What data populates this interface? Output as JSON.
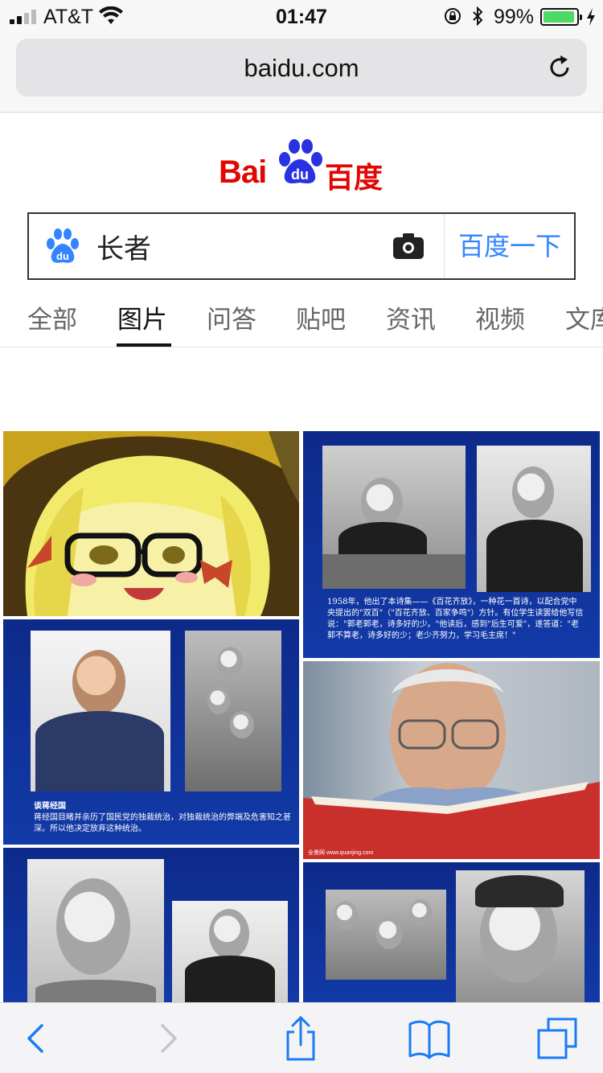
{
  "status_bar": {
    "carrier": "AT&T",
    "time": "01:47",
    "battery_percent": "99%",
    "battery_level": 0.99
  },
  "address_bar": {
    "url": "baidu.com"
  },
  "baidu": {
    "logo_text": "Bai",
    "logo_du": "du",
    "logo_cn": "百度",
    "search_value": "长者",
    "search_button": "百度一下"
  },
  "tabs": [
    {
      "label": "全部"
    },
    {
      "label": "图片",
      "active": true
    },
    {
      "label": "问答"
    },
    {
      "label": "贴吧"
    },
    {
      "label": "资讯"
    },
    {
      "label": "视频"
    },
    {
      "label": "文库"
    }
  ],
  "images": {
    "caption_1": "1958年，他出了本诗集——《百花齐放》，一种花一首诗，以配合党中央提出的\"双百\"（\"百花齐放、百家争鸣\"）方针。有位学生读罢给他写信说：\"郭老郭老，诗多好的少。\"他读后，感到\"后生可爱\"，遂答道：\"老郭不算老，诗多好的少；老少齐努力，学习毛主席！\"",
    "caption_2_title": "谈蒋经国",
    "caption_2": "蒋经国目睹并亲历了国民党的独裁统治，对独裁统治的弊端及危害知之甚深。所以他决定放弃这种统治。",
    "watermark": "全景网 www.quanjing.com"
  },
  "colors": {
    "baidu_red": "#e10601",
    "baidu_blue": "#2932e1",
    "link_blue": "#3385ff",
    "ios_blue": "#1a7cf5"
  }
}
